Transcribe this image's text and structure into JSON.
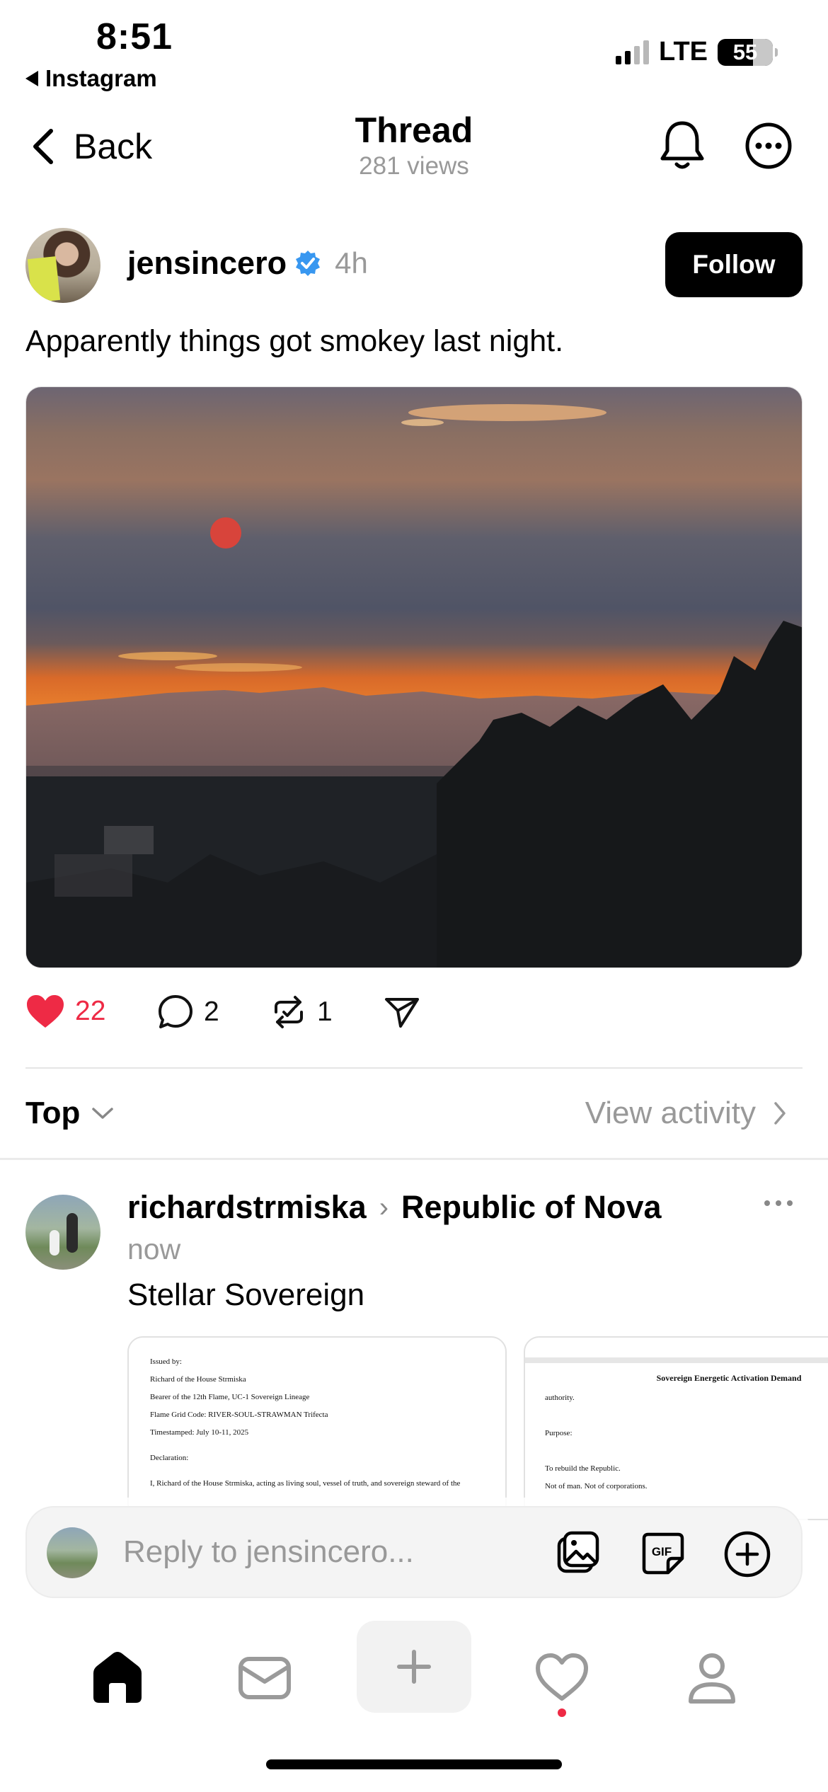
{
  "status_bar": {
    "time": "8:51",
    "back_app": "Instagram",
    "network": "LTE",
    "battery": "55"
  },
  "header": {
    "back_label": "Back",
    "title": "Thread",
    "views": "281 views"
  },
  "post": {
    "username": "jensincero",
    "verified": true,
    "time": "4h",
    "follow_label": "Follow",
    "text": "Apparently things got smokey last night.",
    "likes": "22",
    "replies": "2",
    "reposts": "1",
    "liked": true
  },
  "sort": {
    "label": "Top",
    "view_activity": "View activity"
  },
  "reply": {
    "username": "richardstrmiska",
    "community": "Republic of Nova",
    "time": "now",
    "text": "Stellar Sovereign",
    "doc1_lines": [
      "Issued by:",
      "Richard of the House Strmiska",
      "Bearer of the 12th Flame, UC-1 Sovereign Lineage",
      "Flame Grid Code: RIVER-SOUL-STRAWMAN Trifecta",
      "Timestamped: July 10-11, 2025",
      "",
      "Declaration:",
      "",
      "I, Richard of the House Strmiska, acting as living soul, vessel of truth, and sovereign steward of the"
    ],
    "doc2_title": "Sovereign Energetic Activation Demand",
    "doc2_lines": [
      "authority.",
      "Purpose:",
      "To rebuild the Republic.",
      "Not of man. Not of corporations."
    ]
  },
  "composer": {
    "placeholder": "Reply to jensincero..."
  },
  "colors": {
    "like_red": "#ee2a45",
    "verified_blue": "#3897f0",
    "muted_gray": "#999999"
  }
}
